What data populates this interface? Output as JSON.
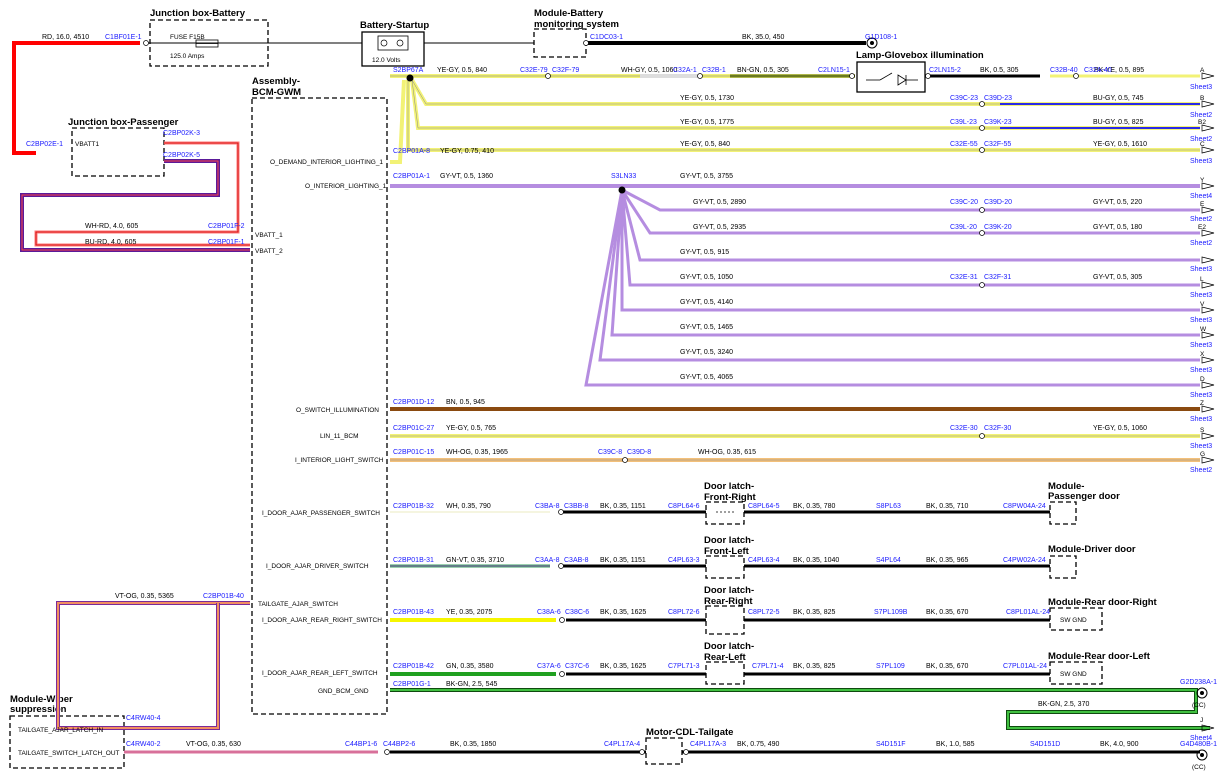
{
  "components": {
    "junction_box_battery": "Junction box-Battery",
    "fuse_label": "FUSE F15B",
    "fuse_rating": "125.0 Amps",
    "battery_startup": "Battery-Startup",
    "battery_voltage": "12.0 Volts",
    "module_battery_line1": "Module-Battery",
    "module_battery_line2": "monitoring system",
    "lamp_glovebox": "Lamp-Glovebox illumination",
    "junction_box_passenger": "Junction box-Passenger",
    "vbatt1": "VBATT1",
    "assembly_bcm_line1": "Assembly-",
    "assembly_bcm_line2": "BCM-GWM",
    "door_latch_fr_line1": "Door latch-",
    "door_latch_fr_line2": "Front-Right",
    "door_latch_fl_line1": "Door latch-",
    "door_latch_fl_line2": "Front-Left",
    "door_latch_rr_line1": "Door latch-",
    "door_latch_rr_line2": "Rear-Right",
    "door_latch_rl_line1": "Door latch-",
    "door_latch_rl_line2": "Rear-Left",
    "module_passenger_door_line1": "Module-",
    "module_passenger_door_line2": "Passenger door",
    "module_driver_door": "Module-Driver door",
    "module_rear_door_right": "Module-Rear door-Right",
    "module_rear_door_left": "Module-Rear door-Left",
    "sw_gnd": "SW GND",
    "motor_cdl_tailgate": "Motor-CDL-Tailgate",
    "module_wiper_line1": "Module-Wiper",
    "module_wiper_line2": "suppression"
  },
  "pins": {
    "o_demand": "O_DEMAND_INTERIOR_LIGHTING_1",
    "o_interior": "O_INTERIOR_LIGHTING_1",
    "vbatt_1": "VBATT_1",
    "vbatt_2": "VBATT_2",
    "o_switch_illum": "O_SWITCH_ILLUMINATION",
    "lin_11": "LIN_11_BCM",
    "i_interior_light": "I_INTERIOR_LIGHT_SWITCH",
    "i_door_pass": "I_DOOR_AJAR_PASSENGER_SWITCH",
    "i_door_driver": "I_DOOR_AJAR_DRIVER_SWITCH",
    "tailgate_ajar_sw": "TAILGATE_AJAR_SWITCH",
    "i_door_rr": "I_DOOR_AJAR_REAR_RIGHT_SWITCH",
    "i_door_rl": "I_DOOR_AJAR_REAR_LEFT_SWITCH",
    "gnd_bcm": "GND_BCM_GND",
    "tailgate_ajar_latch": "TAILGATE_AJAR_LATCH_IN",
    "tailgate_switch_latch": "TAILGATE_SWITCH_LATCH_OUT"
  },
  "connectors": {
    "c1bf01e1": "C1BF01E-1",
    "c1dc03": "C1DC03-1",
    "g1d108": "G1D108-1",
    "s2bp67a": "S2BP67A",
    "c32e79": "C32E-79",
    "c32f79": "C32F-79",
    "c32a1": "C32A-1",
    "c32b1": "C32B-1",
    "c2ln151": "C2LN15-1",
    "c2ln152": "C2LN15-2",
    "c32b40": "C32B-40",
    "c32a40": "C32A-40",
    "c2bp02e1": "C2BP02E-1",
    "c2bp02k3": "C2BP02K-3",
    "c2bp02k5": "C2BP02K-5",
    "c39c23": "C39C-23",
    "c39d23": "C39D-23",
    "c39l23": "C39L-23",
    "c39k23": "C39K-23",
    "c32e55": "C32E-55",
    "c32f55": "C32F-55",
    "c2bp01a8": "C2BP01A-8",
    "c2bp01a1": "C2BP01A-1",
    "s3ln33": "S3LN33",
    "c39c20": "C39C-20",
    "c39d20": "C39D-20",
    "c39l20": "C39L-20",
    "c39k20": "C39K-20",
    "c32e31": "C32E-31",
    "c32f31": "C32F-31",
    "c2bp01f2": "C2BP01F-2",
    "c2bp01f1": "C2BP01F-1",
    "c2bp01d12": "C2BP01D-12",
    "c2bp01c27": "C2BP01C-27",
    "c32e30": "C32E-30",
    "c32f30": "C32F-30",
    "c2bp01c15": "C2BP01C-15",
    "c39c8": "C39C-8",
    "c39d8": "C39D-8",
    "c2bp01b32": "C2BP01B-32",
    "c3ba8": "C3BA-8",
    "c3bb8": "C3BB-8",
    "c8pl646": "C8PL64-6",
    "c8pl645": "C8PL64-5",
    "s8pl63": "S8PL63",
    "c8pw04a24": "C8PW04A-24",
    "c2bp01b31": "C2BP01B-31",
    "c3aa8": "C3AA-8",
    "c3ab8": "C3AB-8",
    "c4pl633": "C4PL63-3",
    "c4pl634": "C4PL63-4",
    "s4pl64": "S4PL64",
    "c4pw02a24": "C4PW02A-24",
    "c2bp01b40": "C2BP01B-40",
    "c2bp01b43": "C2BP01B-43",
    "c38a6": "C38A-6",
    "c38c6": "C38C-6",
    "c8pl726": "C8PL72-6",
    "c8pl725": "C8PL72-5",
    "s7pl109b": "S7PL109B",
    "c8pl01al24": "C8PL01AL-24",
    "c2bp01b42": "C2BP01B-42",
    "c37a6": "C37A-6",
    "c37c6": "C37C-6",
    "c7pl713": "C7PL71-3",
    "c7pl714": "C7PL71-4",
    "s7pl109": "S7PL109",
    "c7pl01al24": "C7PL01AL-24",
    "c2bp01g1": "C2BP01G-1",
    "g2d238a1": "G2D238A-1",
    "c4rw404": "C4RW40-4",
    "c4rw402": "C4RW40-2",
    "c44bp16": "C44BP1-6",
    "c44bp26": "C44BP2-6",
    "c4pl17a4": "C4PL17A-4",
    "c4pl17a3": "C4PL17A-3",
    "s4d151f": "S4D151F",
    "s4d151d": "S4D151D",
    "g4d480b1": "G4D480B-1"
  },
  "wires": {
    "rd_16": "RD, 16.0, 4510",
    "bk_35": "BK, 35.0, 450",
    "ye_gy_840a": "YE-GY, 0.5, 840",
    "wh_gy": "WH-GY, 0.5, 1060",
    "bn_gn": "BN-GN, 0.5, 305",
    "bk_305": "BK, 0.5, 305",
    "bk_ye": "BK-YE, 0.5, 895",
    "ye_gy_1730": "YE-GY, 0.5, 1730",
    "bu_gy_745": "BU-GY, 0.5, 745",
    "ye_gy_1775": "YE-GY, 0.5, 1775",
    "bu_gy_825": "BU-GY, 0.5, 825",
    "ye_gy_840b": "YE-GY, 0.5, 840",
    "ye_gy_1610": "YE-GY, 0.5, 1610",
    "ye_gy_410": "YE-GY, 0.75, 410",
    "gy_vt_1360": "GY-VT, 0.5, 1360",
    "gy_vt_3755": "GY-VT, 0.5, 3755",
    "gy_vt_2890": "GY-VT, 0.5, 2890",
    "gy_vt_220": "GY-VT, 0.5, 220",
    "gy_vt_2935": "GY-VT, 0.5, 2935",
    "gy_vt_180": "GY-VT, 0.5, 180",
    "gy_vt_915": "GY-VT, 0.5, 915",
    "gy_vt_1050": "GY-VT, 0.5, 1050",
    "gy_vt_305": "GY-VT, 0.5, 305",
    "gy_vt_4140": "GY-VT, 0.5, 4140",
    "gy_vt_1465": "GY-VT, 0.5, 1465",
    "gy_vt_3240": "GY-VT, 0.5, 3240",
    "gy_vt_4065": "GY-VT, 0.5, 4065",
    "wh_rd": "WH-RD, 4.0, 605",
    "bu_rd": "BU-RD, 4.0, 605",
    "bn_945": "BN, 0.5, 945",
    "ye_gy_765": "YE-GY, 0.5, 765",
    "ye_gy_1060": "YE-GY, 0.5, 1060",
    "wh_og_1965": "WH-OG, 0.35, 1965",
    "wh_og_615": "WH-OG, 0.35, 615",
    "wh_790": "WH, 0.35, 790",
    "bk_1151a": "BK, 0.35, 1151",
    "bk_780": "BK, 0.35, 780",
    "bk_710": "BK, 0.35, 710",
    "gn_vt_3710": "GN-VT, 0.35, 3710",
    "bk_1151b": "BK, 0.35, 1151",
    "bk_1040": "BK, 0.35, 1040",
    "bk_965": "BK, 0.35, 965",
    "vt_og_5365": "VT-OG, 0.35, 5365",
    "ye_2075": "YE, 0.35, 2075",
    "bk_1625a": "BK, 0.35, 1625",
    "bk_825a": "BK, 0.35, 825",
    "bk_670a": "BK, 0.35, 670",
    "gn_3580": "GN, 0.35, 3580",
    "bk_1625b": "BK, 0.35, 1625",
    "bk_825b": "BK, 0.35, 825",
    "bk_670b": "BK, 0.35, 670",
    "bk_gn_545": "BK-GN, 2.5, 545",
    "bk_gn_370": "BK-GN, 2.5, 370",
    "vt_og_630": "VT-OG, 0.35, 630",
    "bk_1850": "BK, 0.35, 1850",
    "bk_490": "BK, 0.75, 490",
    "bk_585": "BK, 1.0, 585",
    "bk_900": "BK, 4.0, 900"
  },
  "refs": {
    "a": "A",
    "b": "B",
    "b2": "B2",
    "c": "C",
    "y": "Y",
    "e": "E",
    "e2": "E2",
    "l": "L",
    "v": "V",
    "w": "W",
    "x": "X",
    "d": "D",
    "z": "Z",
    "s": "S",
    "g": "G",
    "j": "J",
    "cc": "(CC)",
    "sheet2": "Sheet2",
    "sheet3": "Sheet3",
    "sheet4": "Sheet4"
  },
  "colors": {
    "red": "#ff0000",
    "black": "#000000",
    "ye_gy": "#f2f276",
    "gy_vt": "#b58de0",
    "bu_gy": "#2a2ae6",
    "bn": "#8a4a10",
    "wh_og": "#f3c07a",
    "gn_vt": "#3aa060",
    "ye": "#f6f600",
    "gn": "#20a020",
    "vt_og": "#d8709a",
    "bn_gn": "#6b7a20",
    "bu_rd": "#5a1a9a",
    "wh_rd": "#ff7777",
    "wh_gy": "#dddddd"
  }
}
